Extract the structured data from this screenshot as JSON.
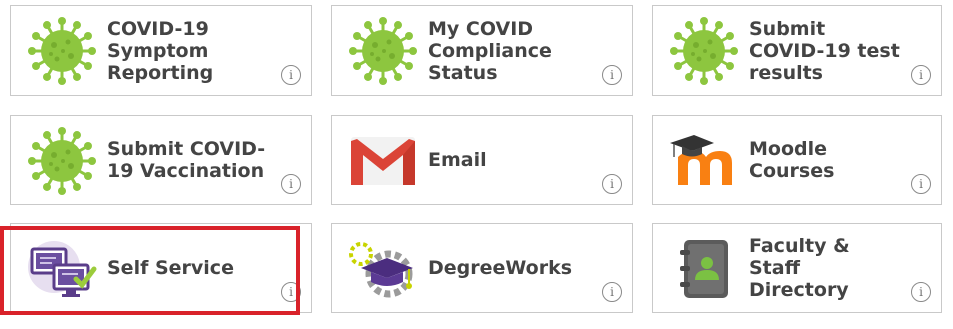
{
  "tiles": [
    {
      "label": "COVID-19 Symptom Reporting",
      "icon": "covid-virus-icon"
    },
    {
      "label": "My COVID Compliance Status",
      "icon": "covid-virus-icon"
    },
    {
      "label": "Submit COVID-19 test results",
      "icon": "covid-virus-icon"
    },
    {
      "label": "Submit COVID-19 Vaccination",
      "icon": "covid-virus-icon"
    },
    {
      "label": "Email",
      "icon": "gmail-icon"
    },
    {
      "label": "Moodle Courses",
      "icon": "moodle-icon"
    },
    {
      "label": "Self Service",
      "icon": "self-service-icon"
    },
    {
      "label": "DegreeWorks",
      "icon": "degreeworks-icon"
    },
    {
      "label": "Faculty & Staff Directory",
      "icon": "directory-icon"
    }
  ],
  "info_glyph": "i",
  "highlighted_tile": "Self Service",
  "colors": {
    "virus": "#8dc63f",
    "highlight": "#d9222a",
    "gmail": "#db4437",
    "moodle": "#f98012"
  }
}
